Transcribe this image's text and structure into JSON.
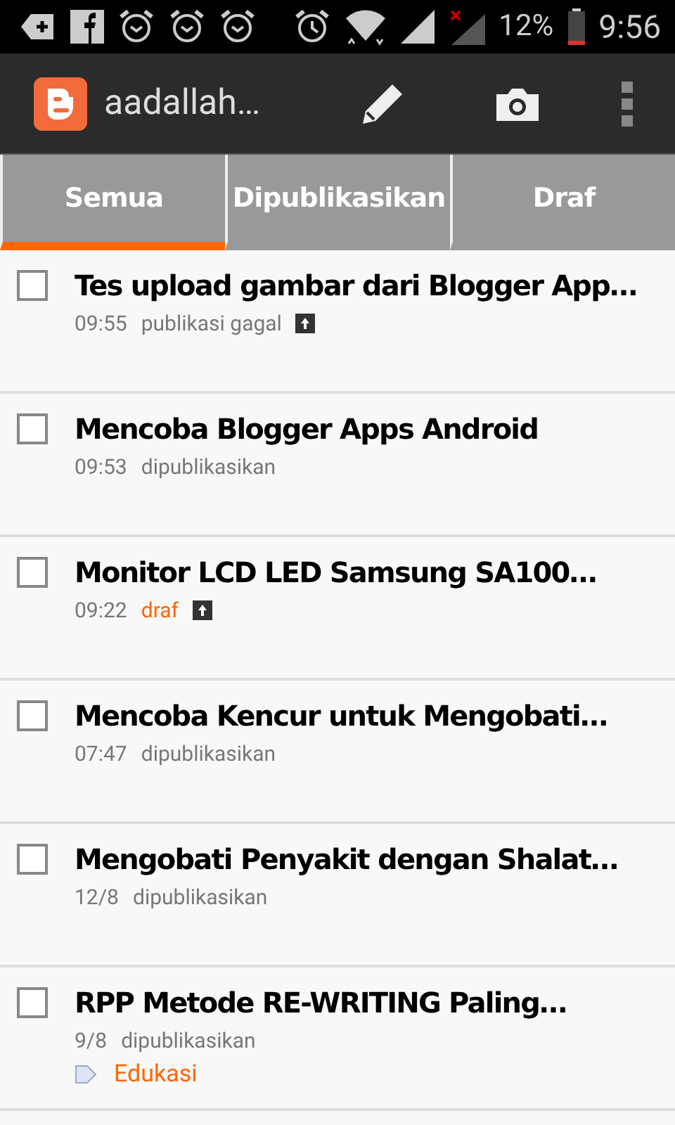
{
  "status_bar": {
    "battery_text": "12%",
    "time": "9:56"
  },
  "app_bar": {
    "title": "aadallah…"
  },
  "tabs": [
    {
      "label": "Semua",
      "selected": true
    },
    {
      "label": "Dipublikasikan",
      "selected": false
    },
    {
      "label": "Draf",
      "selected": false
    }
  ],
  "posts": [
    {
      "title": "Tes upload gambar dari Blogger App…",
      "time": "09:55",
      "status": "publikasi gagal",
      "color": "#777777",
      "upload_icon": true,
      "checked": false
    },
    {
      "title": "Mencoba Blogger Apps Android",
      "time": "09:53",
      "status": "dipublikasikan",
      "color": "#777777",
      "upload_icon": false,
      "checked": false
    },
    {
      "title": "Monitor LCD LED Samsung SA100…",
      "time": "09:22",
      "status": "draf",
      "color": "#ff6600",
      "upload_icon": true,
      "checked": false
    },
    {
      "title": "Mencoba Kencur untuk Mengobati…",
      "time": "07:47",
      "status": "dipublikasikan",
      "color": "#777777",
      "upload_icon": false,
      "checked": false
    },
    {
      "title": "Mengobati Penyakit dengan Shalat…",
      "time": "12/8",
      "status": "dipublikasikan",
      "color": "#777777",
      "upload_icon": false,
      "checked": false
    },
    {
      "title": "RPP Metode RE-WRITING Paling…",
      "time": "9/8",
      "status": "dipublikasikan",
      "color": "#777777",
      "upload_icon": false,
      "checked": false,
      "labels": [
        "Edukasi"
      ]
    }
  ]
}
